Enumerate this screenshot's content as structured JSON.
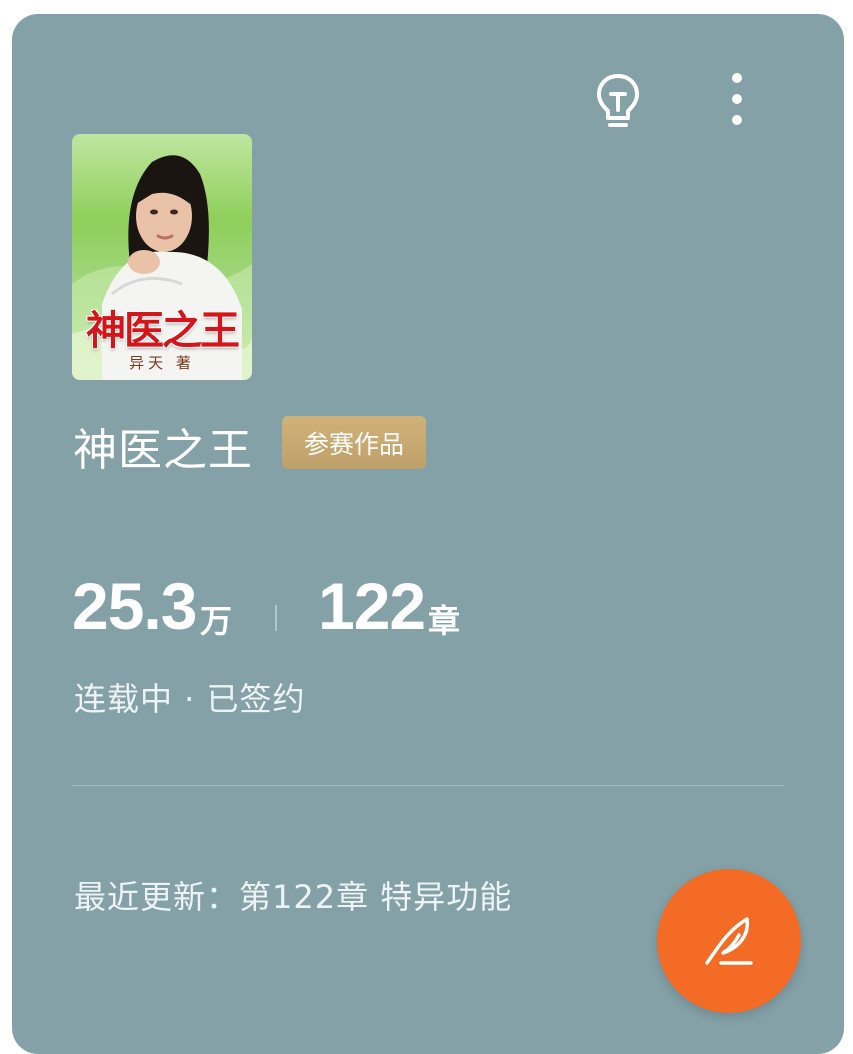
{
  "header": {
    "idea_icon": "lightbulb-icon",
    "more_icon": "more-vertical-icon"
  },
  "cover": {
    "title": "神医之王",
    "author": "异天 著"
  },
  "book": {
    "title": "神医之王",
    "badge": "参赛作品"
  },
  "stats": {
    "words_value": "25.3",
    "words_unit": "万",
    "chapters_value": "122",
    "chapters_unit": "章"
  },
  "status_text": "连载中 · 已签约",
  "latest_update": "最近更新：第122章 特异功能",
  "fab_icon": "quill-write-icon",
  "colors": {
    "card_bg": "#84a1a8",
    "badge_gold": "#c9ab72",
    "fab_orange": "#f36b24"
  }
}
